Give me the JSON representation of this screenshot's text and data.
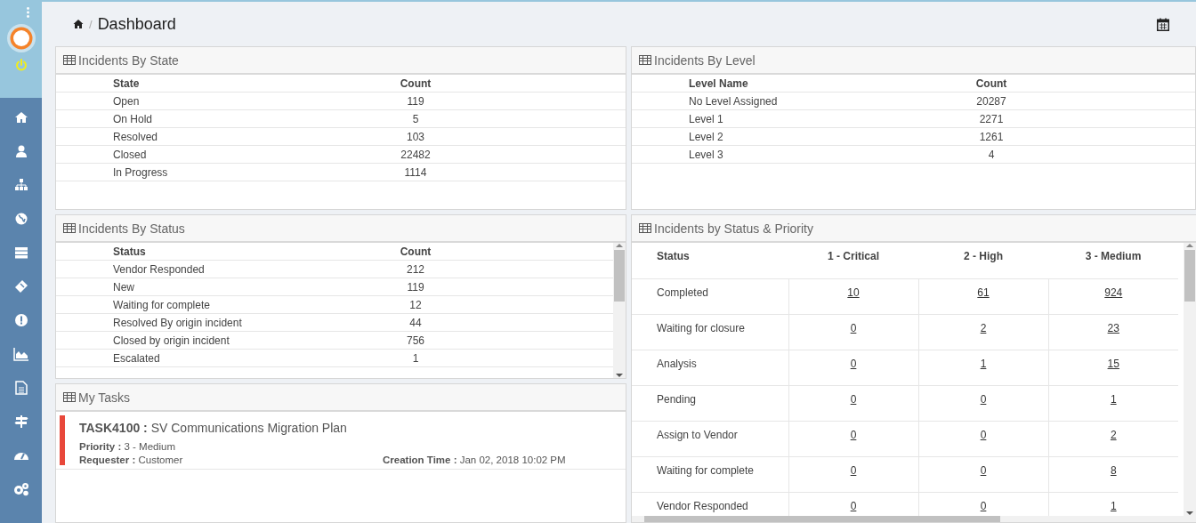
{
  "header": {
    "separator": "/",
    "title": "Dashboard"
  },
  "panels": [
    {
      "kind": "table",
      "title": "Incidents By State",
      "columns": [
        "State",
        "Count"
      ],
      "rows": [
        [
          "Open",
          "119"
        ],
        [
          "On Hold",
          "5"
        ],
        [
          "Resolved",
          "103"
        ],
        [
          "Closed",
          "22482"
        ],
        [
          "In Progress",
          "1114"
        ]
      ]
    },
    {
      "kind": "table",
      "title": "Incidents By Level",
      "columns": [
        "Level Name",
        "Count"
      ],
      "rows": [
        [
          "No Level Assigned",
          "20287"
        ],
        [
          "Level 1",
          "2271"
        ],
        [
          "Level 2",
          "1261"
        ],
        [
          "Level 3",
          "4"
        ]
      ]
    },
    {
      "kind": "scroll-table",
      "title": "Incidents By Status",
      "columns": [
        "Status",
        "Count"
      ],
      "rows": [
        [
          "Vendor Responded",
          "212"
        ],
        [
          "New",
          "119"
        ],
        [
          "Waiting for complete",
          "12"
        ],
        [
          "Resolved By origin incident",
          "44"
        ],
        [
          "Closed by origin incident",
          "756"
        ],
        [
          "Escalated",
          "1"
        ]
      ]
    },
    {
      "kind": "matrix",
      "title": "Incidents by Status & Priority",
      "columns": [
        "Status",
        "1 - Critical",
        "2 - High",
        "3 - Medium"
      ],
      "rows": [
        [
          "Completed",
          "10",
          "61",
          "924"
        ],
        [
          "Waiting for closure",
          "0",
          "2",
          "23"
        ],
        [
          "Analysis",
          "0",
          "1",
          "15"
        ],
        [
          "Pending",
          "0",
          "0",
          "1"
        ],
        [
          "Assign to Vendor",
          "0",
          "0",
          "2"
        ],
        [
          "Waiting for complete",
          "0",
          "0",
          "8"
        ],
        [
          "Vendor Responded",
          "0",
          "0",
          "1"
        ]
      ]
    },
    {
      "kind": "tasks",
      "title": "My Tasks",
      "tasks": [
        {
          "color": "#e8483b",
          "title": "**TASK4100 :** SV Communications Migration Plan",
          "priority": "**Priority :** 3 - Medium",
          "requester": "**Requester :** Customer",
          "created": "**Creation Time :** Jan 02, 2018 10:02 PM"
        }
      ]
    }
  ]
}
